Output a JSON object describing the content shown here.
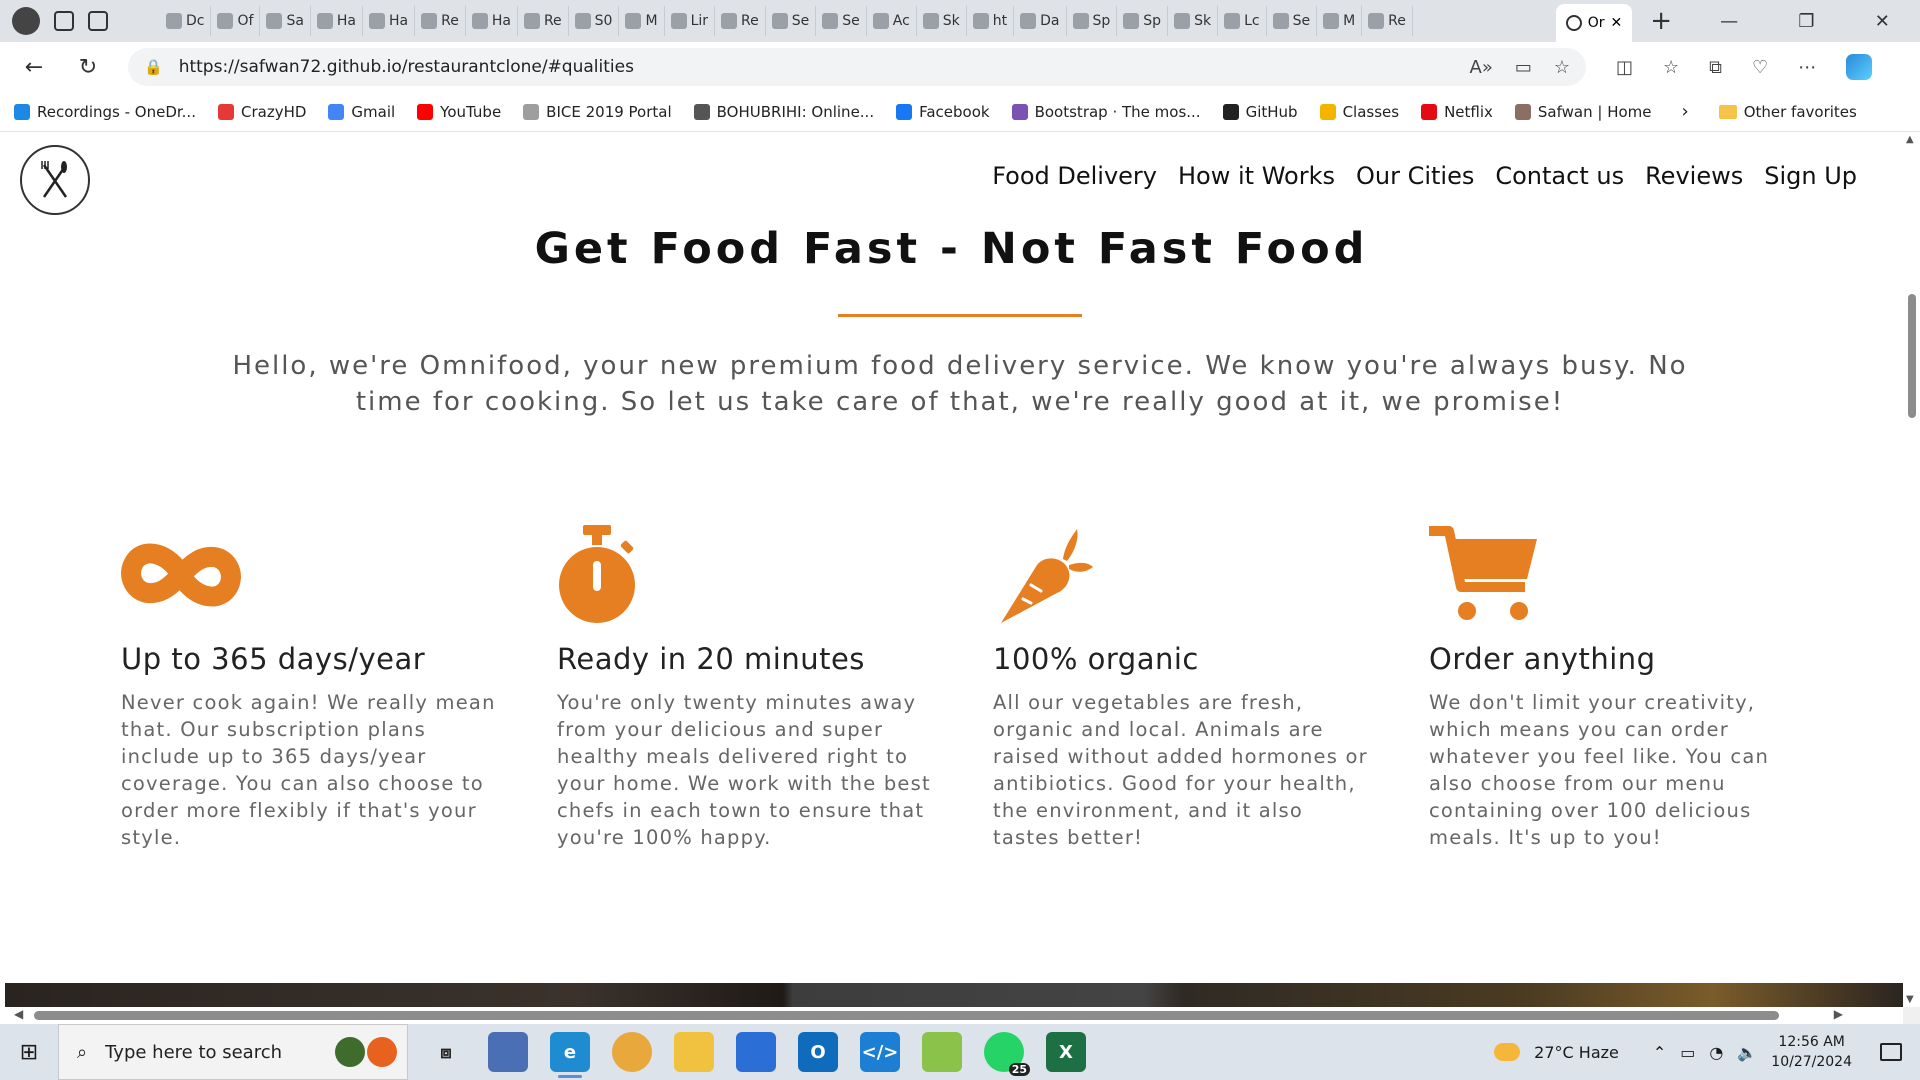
{
  "browser": {
    "tabs": [
      "Dc",
      "Of",
      "Sa",
      "Ha",
      "Ha",
      "Re",
      "Ha",
      "Re",
      "S0",
      "M",
      "Lir",
      "Re",
      "Se",
      "Se",
      "Ac",
      "Sk",
      "ht",
      "Da",
      "Sp",
      "Sp",
      "Sk",
      "Lc",
      "Se",
      "M",
      "Re"
    ],
    "active_tab": "Or",
    "url": "https://safwan72.github.io/restaurantclone/#qualities",
    "favorites": [
      {
        "label": "Recordings - OneDr...",
        "color": "#1e88e5"
      },
      {
        "label": "CrazyHD",
        "color": "#e53935"
      },
      {
        "label": "Gmail",
        "color": "#4285f4"
      },
      {
        "label": "YouTube",
        "color": "#ff0000"
      },
      {
        "label": "BICE 2019 Portal",
        "color": "#9e9e9e"
      },
      {
        "label": "BOHUBRIHI: Online...",
        "color": "#555555"
      },
      {
        "label": "Facebook",
        "color": "#1877f2"
      },
      {
        "label": "Bootstrap · The mos...",
        "color": "#7952b3"
      },
      {
        "label": "GitHub",
        "color": "#222222"
      },
      {
        "label": "Classes",
        "color": "#f5b400"
      },
      {
        "label": "Netflix",
        "color": "#e50914"
      },
      {
        "label": "Safwan | Home",
        "color": "#8d6e63"
      }
    ],
    "other_favorites": "Other favorites"
  },
  "page": {
    "nav": [
      "Food Delivery",
      "How it Works",
      "Our Cities",
      "Contact us",
      "Reviews",
      "Sign Up"
    ],
    "hero_title": "Get Food Fast - Not Fast Food",
    "hero_text": "Hello, we're Omnifood, your new premium food delivery service. We know you're always busy. No time for cooking. So let us take care of that, we're really good at it, we promise!",
    "accent": "#e67e22",
    "features": [
      {
        "icon": "infinity-icon",
        "title": "Up to 365 days/year",
        "text": "Never cook again! We really mean that. Our subscription plans include up to 365 days/year coverage. You can also choose to order more flexibly if that's your style."
      },
      {
        "icon": "stopwatch-icon",
        "title": "Ready in 20 minutes",
        "text": "You're only twenty minutes away from your delicious and super healthy meals delivered right to your home. We work with the best chefs in each town to ensure that you're 100% happy."
      },
      {
        "icon": "carrot-icon",
        "title": "100% organic",
        "text": "All our vegetables are fresh, organic and local. Animals are raised without added hormones or antibiotics. Good for your health, the environment, and it also tastes better!"
      },
      {
        "icon": "cart-icon",
        "title": "Order anything",
        "text": "We don't limit your creativity, which means you can order whatever you feel like. You can also choose from our menu containing over 100 delicious meals. It's up to you!"
      }
    ]
  },
  "taskbar": {
    "search_placeholder": "Type here to search",
    "whatsapp_badge": "25",
    "weather": "27°C  Haze",
    "time": "12:56 AM",
    "date": "10/27/2024"
  }
}
